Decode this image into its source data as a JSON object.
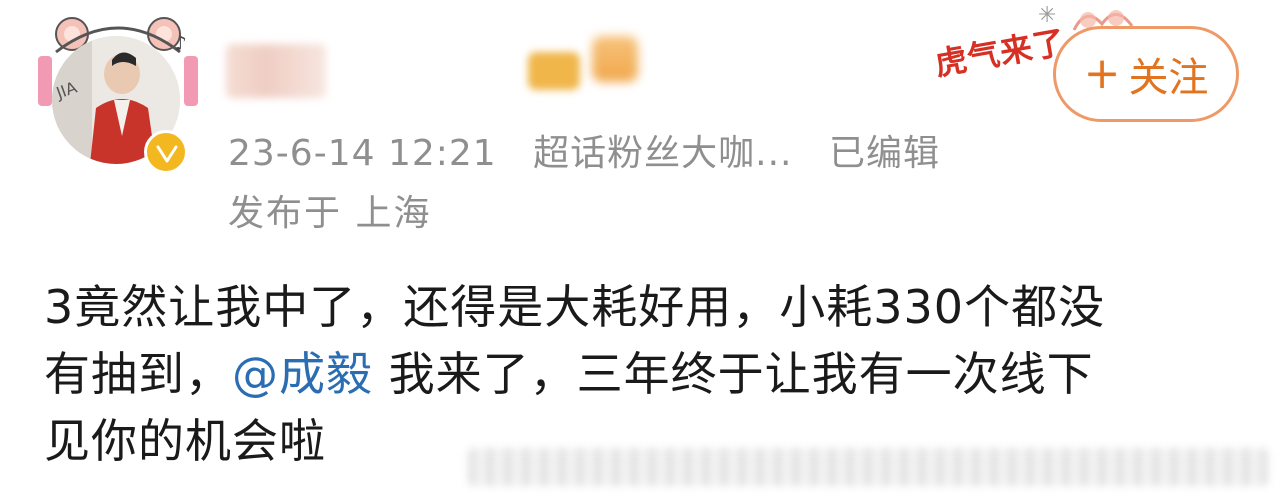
{
  "post": {
    "timestamp": "23-6-14 12:21",
    "source": "超话粉丝大咖...",
    "edited": "已编辑",
    "location": "发布于 上海",
    "body_line1": "3竟然让我中了，还得是大耗好用，小耗330个都没",
    "body_line2_prefix": "有抽到，",
    "mention": "@成毅",
    "body_line2_suffix": " 我来了，三年终于让我有一次线下",
    "body_line3": "见你的机会啦"
  },
  "follow_button": {
    "plus": "+",
    "label": "关注"
  },
  "sticker": {
    "text": "虎气来了"
  },
  "colors": {
    "meta_text": "#8f8f8f",
    "body_text": "#1a1a1a",
    "mention": "#2b6db3",
    "follow_accent": "#e2731f",
    "verified": "#f3b71f",
    "sticker_red": "#d62f23"
  }
}
